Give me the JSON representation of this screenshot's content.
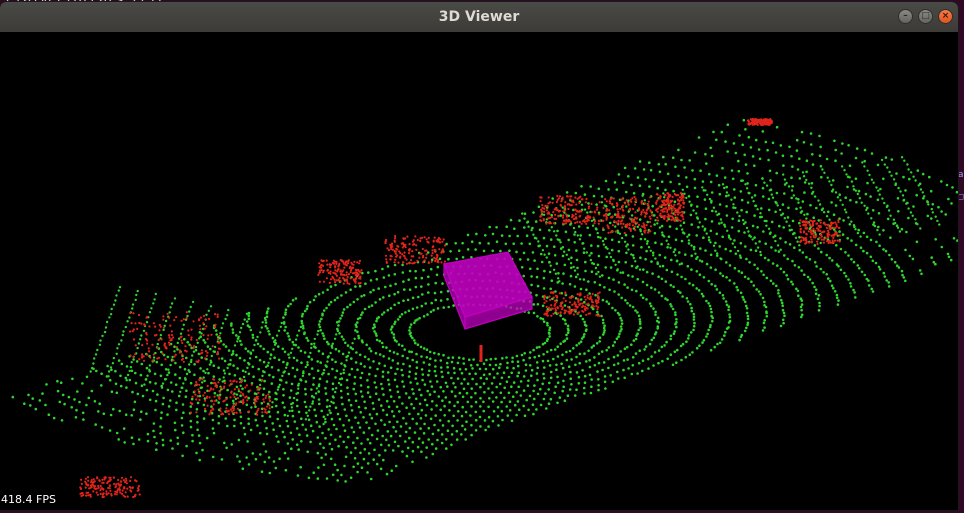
{
  "window": {
    "title": "3D Viewer",
    "buttons": {
      "minimize": "–",
      "maximize": "□",
      "close": "×"
    }
  },
  "viewer": {
    "fps": "418.4 FPS",
    "background": "#000000",
    "ground_color": "#2ed52e",
    "obstacle_color": "#e0241c",
    "bbox_color": "#c000c0"
  },
  "background_terminal": {
    "text": "elaivectorcars cetc"
  }
}
